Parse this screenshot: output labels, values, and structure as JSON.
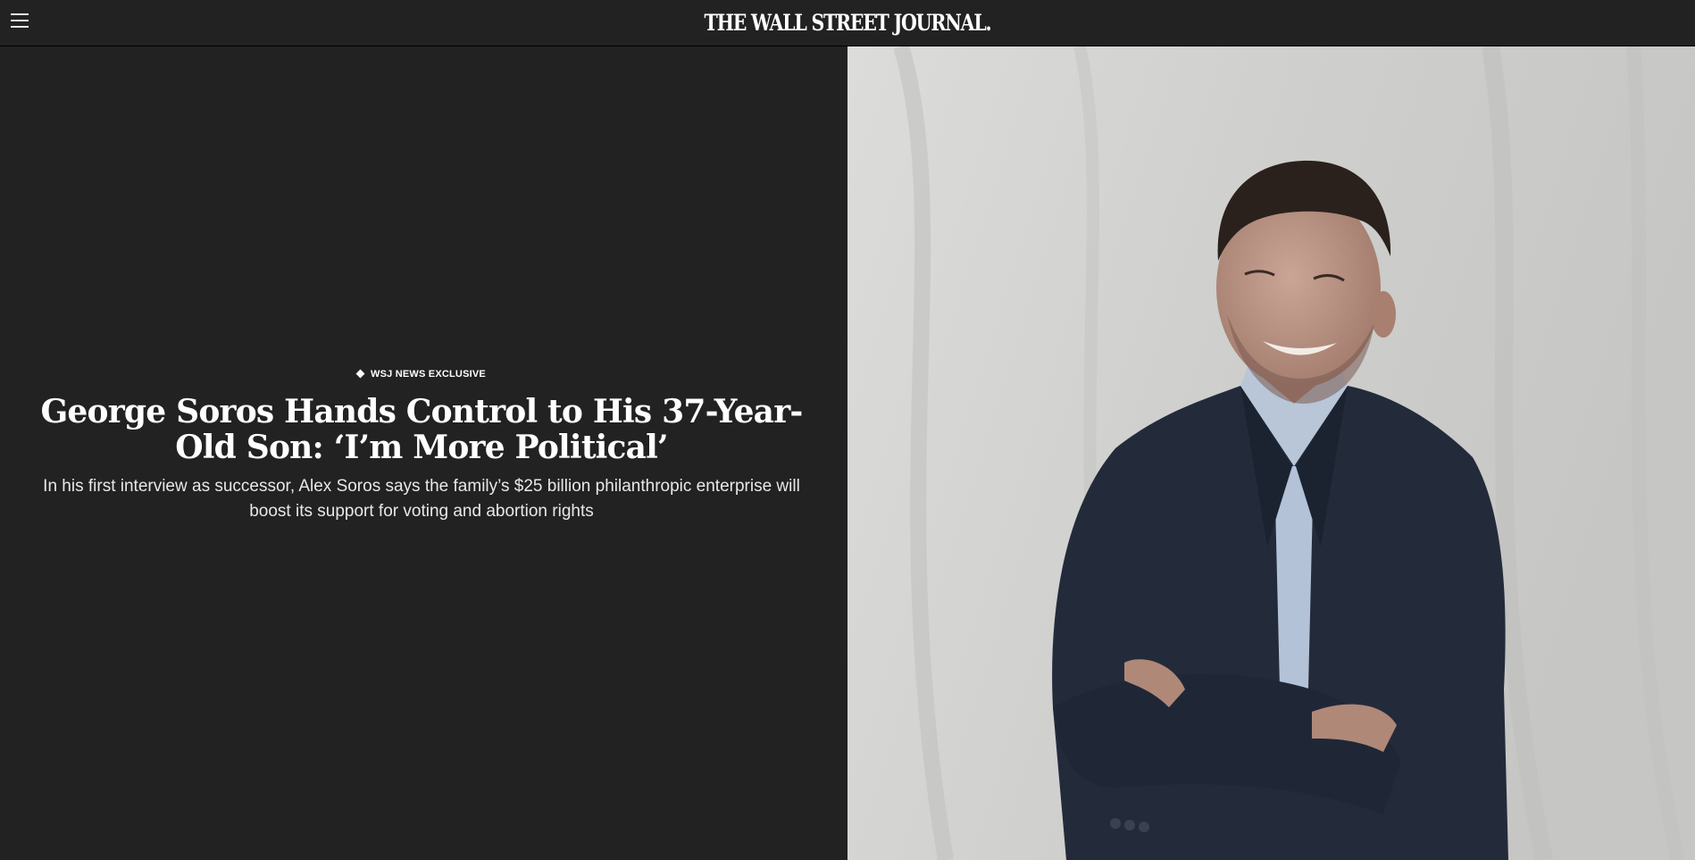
{
  "header": {
    "menu_icon": "hamburger-menu-icon",
    "logo_text": "THE WALL STREET JOURNAL."
  },
  "article": {
    "flashline": "WSJ NEWS EXCLUSIVE",
    "flashline_icon": "diamond-icon",
    "headline": "George Soros Hands Control to His 37-Year-Old Son: ‘I’m More Political’",
    "dek": "In his first interview as successor, Alex Soros says the family’s $25 billion philanthropic enterprise will boost its support for voting and abortion rights"
  },
  "colors": {
    "background": "#222222",
    "text": "#ffffff",
    "photo_backdrop": "#d3d3d1",
    "suit": "#232b3b",
    "shirt": "#b8c6d8"
  }
}
